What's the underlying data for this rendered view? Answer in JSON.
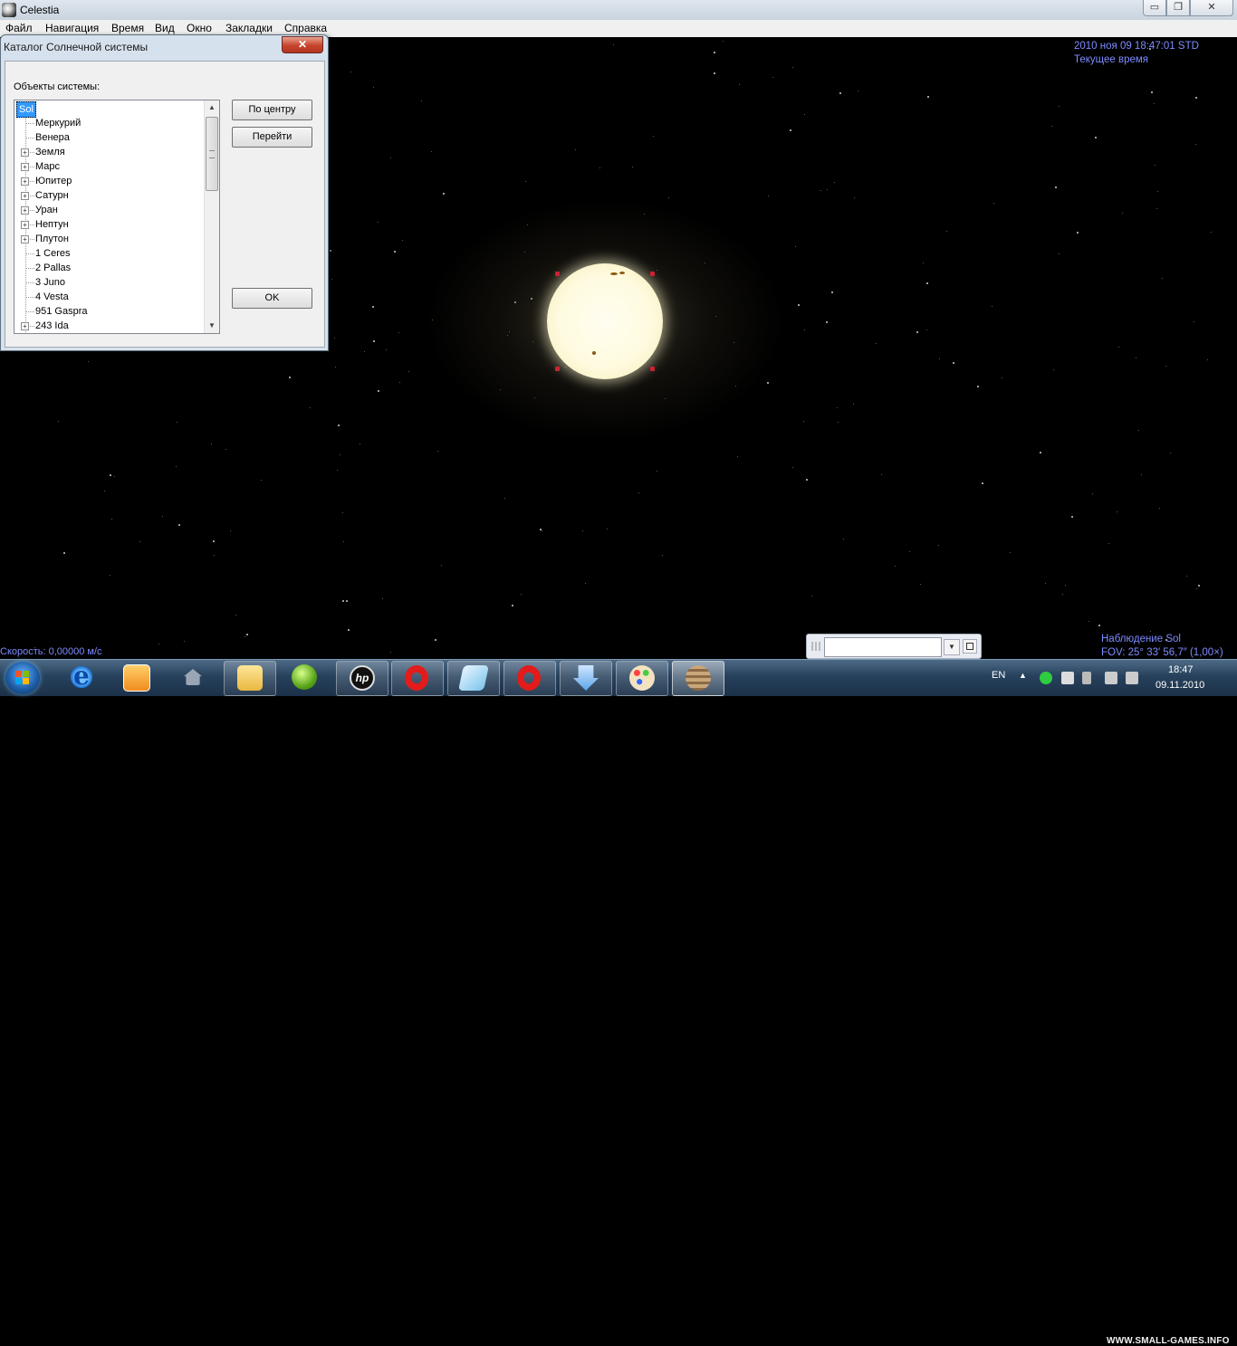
{
  "window": {
    "title": "Celestia",
    "controls": {
      "minimize": "▭",
      "maximize": "❐",
      "close": "✕"
    }
  },
  "menu": [
    "Файл",
    "Навигация",
    "Время",
    "Вид",
    "Окно",
    "Закладки",
    "Справка"
  ],
  "overlay": {
    "datetime": "2010 ноя 09 18:47:01 STD",
    "time_mode": "Текущее время",
    "speed": "Скорость: 0,00000 м/с",
    "observing": "Наблюдение Sol",
    "fov": "FOV: 25° 33′ 56,7″ (1,00×)"
  },
  "dialog": {
    "title": "Каталог Солнечной системы",
    "close_label": "✕",
    "objects_label": "Объекты системы:",
    "tree": [
      {
        "label": "Sol",
        "expandable": false,
        "selected": true,
        "root": true
      },
      {
        "label": "Меркурий",
        "expandable": false
      },
      {
        "label": "Венера",
        "expandable": false
      },
      {
        "label": "Земля",
        "expandable": true
      },
      {
        "label": "Марс",
        "expandable": true
      },
      {
        "label": "Юпитер",
        "expandable": true
      },
      {
        "label": "Сатурн",
        "expandable": true
      },
      {
        "label": "Уран",
        "expandable": true
      },
      {
        "label": "Нептун",
        "expandable": true
      },
      {
        "label": "Плутон",
        "expandable": true
      },
      {
        "label": "1 Ceres",
        "expandable": false
      },
      {
        "label": "2 Pallas",
        "expandable": false
      },
      {
        "label": "3 Juno",
        "expandable": false
      },
      {
        "label": "4 Vesta",
        "expandable": false
      },
      {
        "label": "951 Gaspra",
        "expandable": false
      },
      {
        "label": "243 Ida",
        "expandable": true
      }
    ],
    "buttons": {
      "center": "По центру",
      "goto": "Перейти",
      "ok": "OK"
    }
  },
  "search": {
    "value": ""
  },
  "taskbar": {
    "items": [
      "start-button",
      "internet-explorer",
      "media-player",
      "home",
      "file-explorer",
      "xbox-game",
      "hp-app",
      "opera-1",
      "notepad",
      "opera-2",
      "download-manager",
      "paint-app",
      "celestia"
    ],
    "tray": {
      "language": "EN",
      "time": "18:47",
      "date": "09.11.2010"
    },
    "watermark": "WWW.SMALL-GAMES.INFO"
  }
}
